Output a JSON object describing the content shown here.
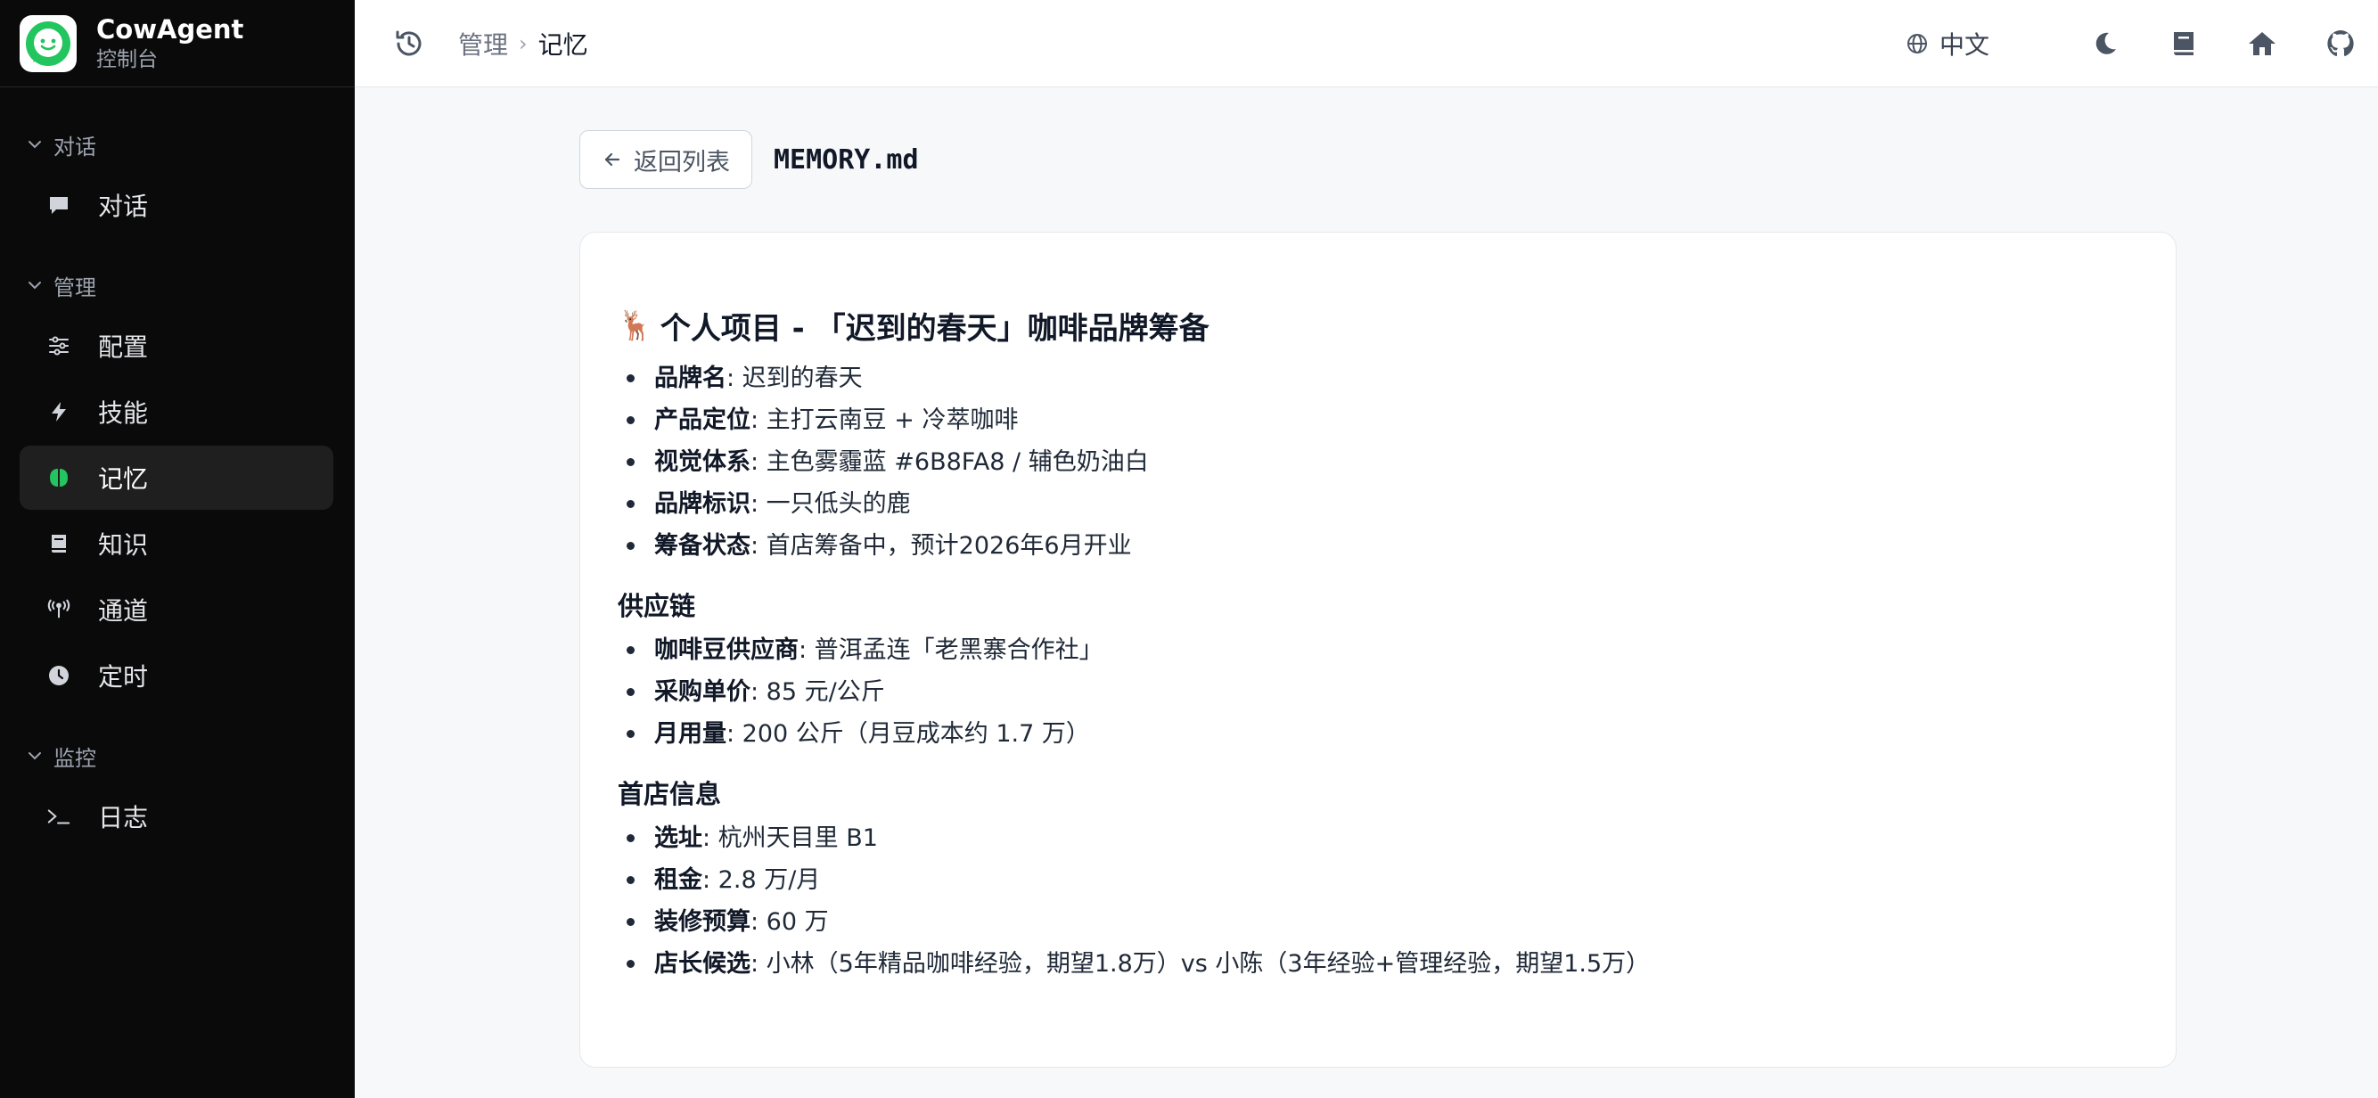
{
  "brand": {
    "name": "CowAgent",
    "subtitle": "控制台",
    "accent": "#22c55e"
  },
  "sidebar": {
    "groups": [
      {
        "label": "对话",
        "items": [
          {
            "label": "对话",
            "icon": "chat-bubble-icon"
          }
        ]
      },
      {
        "label": "管理",
        "items": [
          {
            "label": "配置",
            "icon": "sliders-icon"
          },
          {
            "label": "技能",
            "icon": "lightning-icon"
          },
          {
            "label": "记忆",
            "icon": "brain-icon",
            "active": true
          },
          {
            "label": "知识",
            "icon": "book-icon"
          },
          {
            "label": "通道",
            "icon": "antenna-icon"
          },
          {
            "label": "定时",
            "icon": "clock-icon"
          }
        ]
      },
      {
        "label": "监控",
        "items": [
          {
            "label": "日志",
            "icon": "terminal-icon"
          }
        ]
      }
    ]
  },
  "topbar": {
    "breadcrumb": {
      "parent": "管理",
      "current": "记忆"
    },
    "language": "中文",
    "icons": [
      "moon-icon",
      "book-icon",
      "home-icon",
      "github-icon"
    ]
  },
  "file": {
    "back_label": "返回列表",
    "name": "MEMORY.md"
  },
  "document": {
    "heading": {
      "emoji": "🦌",
      "text": "个人项目 - 「迟到的春天」咖啡品牌筹备"
    },
    "intro_items": [
      {
        "key": "品牌名",
        "value": ": 迟到的春天"
      },
      {
        "key": "产品定位",
        "value": ": 主打云南豆 + 冷萃咖啡"
      },
      {
        "key": "视觉体系",
        "value": ": 主色雾霾蓝 #6B8FA8 / 辅色奶油白"
      },
      {
        "key": "品牌标识",
        "value": ": 一只低头的鹿"
      },
      {
        "key": "筹备状态",
        "value": ": 首店筹备中，预计2026年6月开业"
      }
    ],
    "supply": {
      "title": "供应链",
      "items": [
        {
          "key": "咖啡豆供应商",
          "value": ": 普洱孟连「老黑寨合作社」"
        },
        {
          "key": "采购单价",
          "value": ": 85 元/公斤"
        },
        {
          "key": "月用量",
          "value": ": 200 公斤（月豆成本约 1.7 万）"
        }
      ]
    },
    "store": {
      "title": "首店信息",
      "items": [
        {
          "key": "选址",
          "value": ": 杭州天目里 B1"
        },
        {
          "key": "租金",
          "value": ": 2.8 万/月"
        },
        {
          "key": "装修预算",
          "value": ": 60 万"
        },
        {
          "key": "店长候选",
          "value": ": 小林（5年精品咖啡经验，期望1.8万）vs 小陈（3年经验+管理经验，期望1.5万）"
        }
      ]
    }
  }
}
